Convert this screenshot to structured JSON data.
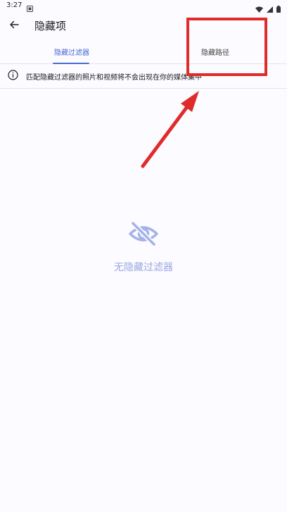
{
  "status_bar": {
    "time": "3:27",
    "icons": [
      "notification-icon",
      "wifi-icon",
      "signal-icon",
      "battery-icon"
    ]
  },
  "app_bar": {
    "title": "隐藏项",
    "back_icon": "arrow-left-icon"
  },
  "tabs": [
    {
      "label": "隐藏过滤器",
      "selected": true
    },
    {
      "label": "隐藏路径",
      "selected": false
    }
  ],
  "info": {
    "icon": "info-icon",
    "text": "匹配隐藏过滤器的照片和视频将不会出现在你的媒体集中"
  },
  "empty_state": {
    "icon": "eye-off-icon",
    "text": "无隐藏过滤器"
  },
  "colors": {
    "accent": "#4a6bd1",
    "empty_text": "#9aa7e3",
    "annotation": "#e02b2b",
    "background": "#fcfbff"
  }
}
